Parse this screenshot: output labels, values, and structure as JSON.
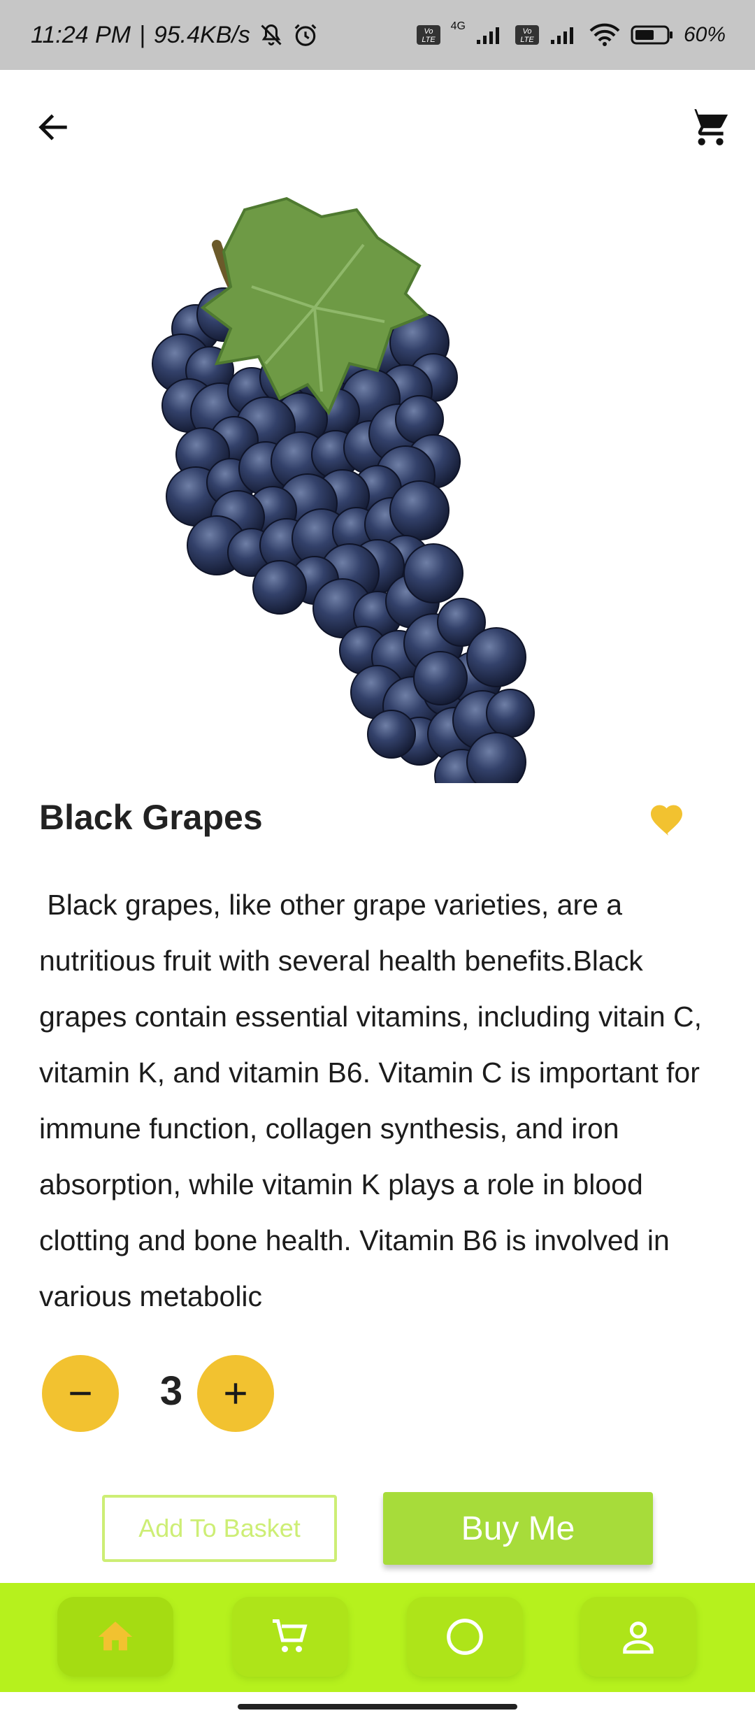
{
  "status_bar": {
    "time": "11:24 PM",
    "separator": "|",
    "speed": "95.4KB/s",
    "network_small": "4G",
    "battery": "60%",
    "icons": [
      "mute-bell-icon",
      "alarm-icon",
      "volte-icon",
      "signal-icon",
      "wifi-icon",
      "battery-icon"
    ]
  },
  "header": {
    "back_icon": "arrow-left-icon",
    "cart_icon": "cart-icon"
  },
  "product": {
    "image": "black-grapes-image",
    "name": "Black Grapes",
    "favorite_icon": "heart-icon",
    "favorite_color": "#f2c230",
    "description": " Black grapes, like other grape varieties, are a nutritious fruit with several health benefits.Black grapes contain essential vitamins, including vitain C, vitamin K, and vitamin B6. Vitamin C is important for immune function, collagen synthesis, and iron absorption, while vitamin K plays a role in blood clotting and bone health. Vitamin B6 is involved in various metabolic"
  },
  "quantity": {
    "value": "3",
    "decrement_icon": "minus-icon",
    "increment_icon": "plus-icon",
    "button_color": "#f2c230"
  },
  "actions": {
    "add_to_basket": "Add To Basket",
    "buy": "Buy Me",
    "accent": "#a7dc3a"
  },
  "bottom_nav": {
    "background": "#b6f11d",
    "items": [
      {
        "icon": "home-icon",
        "active": true
      },
      {
        "icon": "cart-icon",
        "active": false
      },
      {
        "icon": "circle-icon",
        "active": false
      },
      {
        "icon": "profile-icon",
        "active": false
      }
    ]
  }
}
